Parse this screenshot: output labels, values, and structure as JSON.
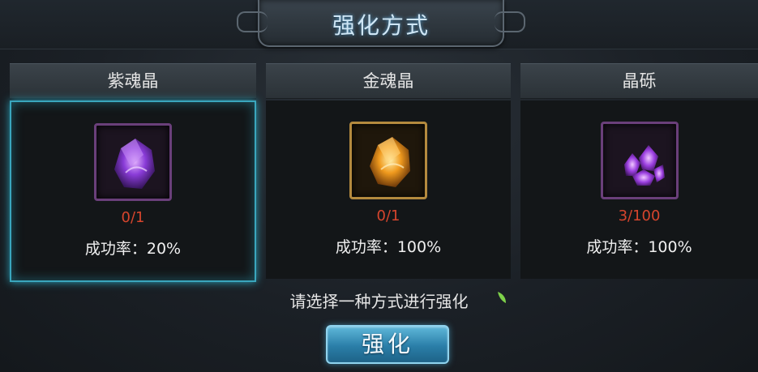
{
  "window": {
    "title": "强化方式"
  },
  "options": [
    {
      "name": "紫魂晶",
      "count": "0/1",
      "rate": "成功率：20%",
      "icon": "purple-soul-crystal-icon",
      "selected": true
    },
    {
      "name": "金魂晶",
      "count": "0/1",
      "rate": "成功率：100%",
      "icon": "gold-soul-crystal-icon",
      "selected": false
    },
    {
      "name": "晶砾",
      "count": "3/100",
      "rate": "成功率：100%",
      "icon": "crystal-shards-icon",
      "selected": false
    }
  ],
  "hint": "请选择一种方式进行强化",
  "action": {
    "label": "强化"
  },
  "colors": {
    "accent": "#3aa6bd",
    "count": "#d6452d",
    "button": "#2a7ea8"
  }
}
